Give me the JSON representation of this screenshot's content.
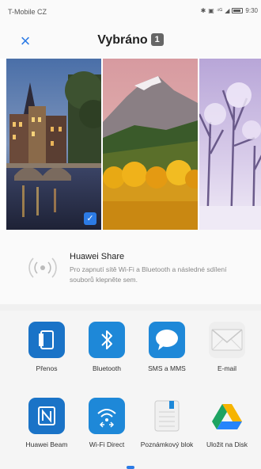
{
  "status_bar": {
    "carrier": "T-Mobile CZ",
    "signal_text": "⁴ᴳ",
    "time": "9:30"
  },
  "header": {
    "title": "Vybráno",
    "selected_count": "1",
    "close_icon": "×"
  },
  "gallery": {
    "photos": [
      {
        "name": "canal-town-photo",
        "selected": true
      },
      {
        "name": "mountain-autumn-photo",
        "selected": false
      },
      {
        "name": "snowy-trees-photo",
        "selected": false
      }
    ],
    "check_mark": "✓"
  },
  "huawei_share": {
    "title": "Huawei Share",
    "description": "Pro zapnutí sítě Wi-Fi a Bluetooth a následné sdílení souborů klepněte sem."
  },
  "apps": [
    {
      "label": "Přenos",
      "icon": "transfer-icon"
    },
    {
      "label": "Bluetooth",
      "icon": "bluetooth-icon"
    },
    {
      "label": "SMS a MMS",
      "icon": "sms-icon"
    },
    {
      "label": "E-mail",
      "icon": "email-icon"
    },
    {
      "label": "Huawei Beam",
      "icon": "nfc-icon"
    },
    {
      "label": "Wi-Fi Direct",
      "icon": "wifi-direct-icon"
    },
    {
      "label": "Poznámkový blok",
      "icon": "notepad-icon"
    },
    {
      "label": "Uložit na Disk",
      "icon": "google-drive-icon"
    }
  ],
  "colors": {
    "accent": "#2c7be5",
    "app_blue": "#1a73c7"
  }
}
